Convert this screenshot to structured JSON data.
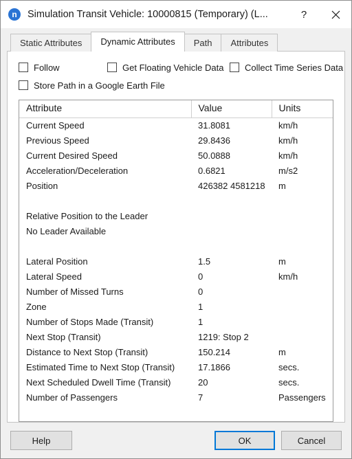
{
  "window": {
    "icon_glyph": "n",
    "title": "Simulation Transit Vehicle: 10000815 (Temporary) (L...",
    "help_label": "?",
    "close_label": "✕"
  },
  "tabs": [
    {
      "label": "Static Attributes",
      "active": false
    },
    {
      "label": "Dynamic Attributes",
      "active": true
    },
    {
      "label": "Path",
      "active": false
    },
    {
      "label": "Attributes",
      "active": false
    }
  ],
  "checkboxes": [
    {
      "label": "Follow",
      "checked": false
    },
    {
      "label": "Get Floating Vehicle Data",
      "checked": false
    },
    {
      "label": "Collect Time Series Data",
      "checked": false
    },
    {
      "label": "Store Path in a Google Earth File",
      "checked": false
    }
  ],
  "table": {
    "headers": [
      "Attribute",
      "Value",
      "Units"
    ],
    "rows": [
      {
        "attribute": "Current Speed",
        "value": "31.8081",
        "units": "km/h"
      },
      {
        "attribute": "Previous Speed",
        "value": "29.8436",
        "units": "km/h"
      },
      {
        "attribute": "Current Desired Speed",
        "value": "50.0888",
        "units": "km/h"
      },
      {
        "attribute": "Acceleration/Deceleration",
        "value": "0.6821",
        "units": "m/s2"
      },
      {
        "attribute": "Position",
        "value": "426382 4581218",
        "units": "m"
      },
      {
        "attribute": "",
        "value": "",
        "units": ""
      },
      {
        "attribute": "Relative Position to the Leader",
        "value": "",
        "units": ""
      },
      {
        "attribute": "No Leader Available",
        "value": "",
        "units": ""
      },
      {
        "attribute": "",
        "value": "",
        "units": ""
      },
      {
        "attribute": "Lateral Position",
        "value": "1.5",
        "units": "m"
      },
      {
        "attribute": "Lateral Speed",
        "value": "0",
        "units": "km/h"
      },
      {
        "attribute": "Number of Missed Turns",
        "value": "0",
        "units": ""
      },
      {
        "attribute": "Zone",
        "value": "1",
        "units": ""
      },
      {
        "attribute": "Number of Stops Made (Transit)",
        "value": "1",
        "units": ""
      },
      {
        "attribute": "Next Stop (Transit)",
        "value": "1219: Stop 2",
        "units": ""
      },
      {
        "attribute": "Distance to Next Stop (Transit)",
        "value": "150.214",
        "units": "m"
      },
      {
        "attribute": "Estimated Time to Next Stop (Transit)",
        "value": "17.1866",
        "units": "secs."
      },
      {
        "attribute": "Next Scheduled Dwell Time (Transit)",
        "value": "20",
        "units": "secs."
      },
      {
        "attribute": "Number of Passengers",
        "value": "7",
        "units": "Passengers"
      }
    ]
  },
  "buttons": {
    "help": "Help",
    "ok": "OK",
    "cancel": "Cancel"
  },
  "colors": {
    "accent": "#0078d7",
    "icon_blue": "#2a74d4",
    "window_bg": "#f0f0f0",
    "panel_bg": "#ffffff"
  }
}
